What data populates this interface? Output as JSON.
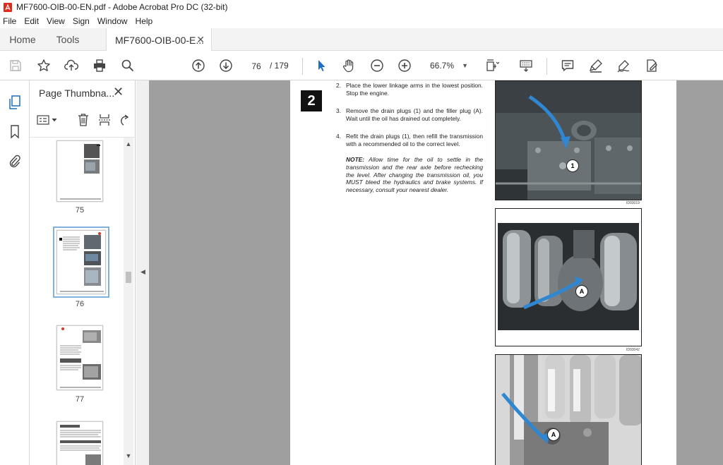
{
  "window": {
    "title": "MF7600-OIB-00-EN.pdf - Adobe Acrobat Pro DC (32-bit)"
  },
  "menu": [
    "File",
    "Edit",
    "View",
    "Sign",
    "Window",
    "Help"
  ],
  "tabs": {
    "home": "Home",
    "tools": "Tools",
    "doc": "MF7600-OIB-00-E...",
    "doc_close": "✕"
  },
  "toolbar": {
    "page_current": "76",
    "page_total": "/ 179",
    "zoom": "66.7%",
    "icons": [
      "save-icon",
      "star-icon",
      "upload-icon",
      "print-icon",
      "search-icon",
      "page-up-icon",
      "page-down-icon",
      "select-cursor-icon",
      "hand-icon",
      "zoom-out-icon",
      "zoom-in-icon",
      "fit-page-icon",
      "keyboard-icon",
      "comment-icon",
      "highlight-icon",
      "sign-icon",
      "edit-pdf-icon"
    ]
  },
  "left_rail": {
    "icons": [
      "pages-icon",
      "bookmark-icon",
      "attachment-icon"
    ]
  },
  "thumbnails_panel": {
    "title": "Page Thumbna...",
    "close": "✕",
    "pages": [
      {
        "label": "75",
        "selected": false
      },
      {
        "label": "76",
        "selected": true
      },
      {
        "label": "77",
        "selected": false
      },
      {
        "label": "",
        "selected": false
      }
    ]
  },
  "document": {
    "step": "2",
    "instructions": [
      {
        "num": "2.",
        "text": "Place the lower linkage arms in the lowest position. Stop the engine."
      },
      {
        "num": "3.",
        "text": "Remove the drain plugs (1) and the filler plug (A). Wait until the oil has drained out completely."
      },
      {
        "num": "4.",
        "text": "Refit the drain plugs (1), then refill the transmission with a recommended oil to the correct level."
      }
    ],
    "note_label": "NOTE:",
    "note": "Allow time for the oil to settle in the transmission and the rear axle before rechecking the level. After changing the transmission oil, you MUST bleed the hydraulics and brake systems. If necessary, consult your nearest dealer.",
    "figures": [
      {
        "callout": "1",
        "code": "ID93019"
      },
      {
        "callout": "A",
        "code": "ID93042"
      },
      {
        "callout": "A",
        "code": ""
      }
    ]
  }
}
